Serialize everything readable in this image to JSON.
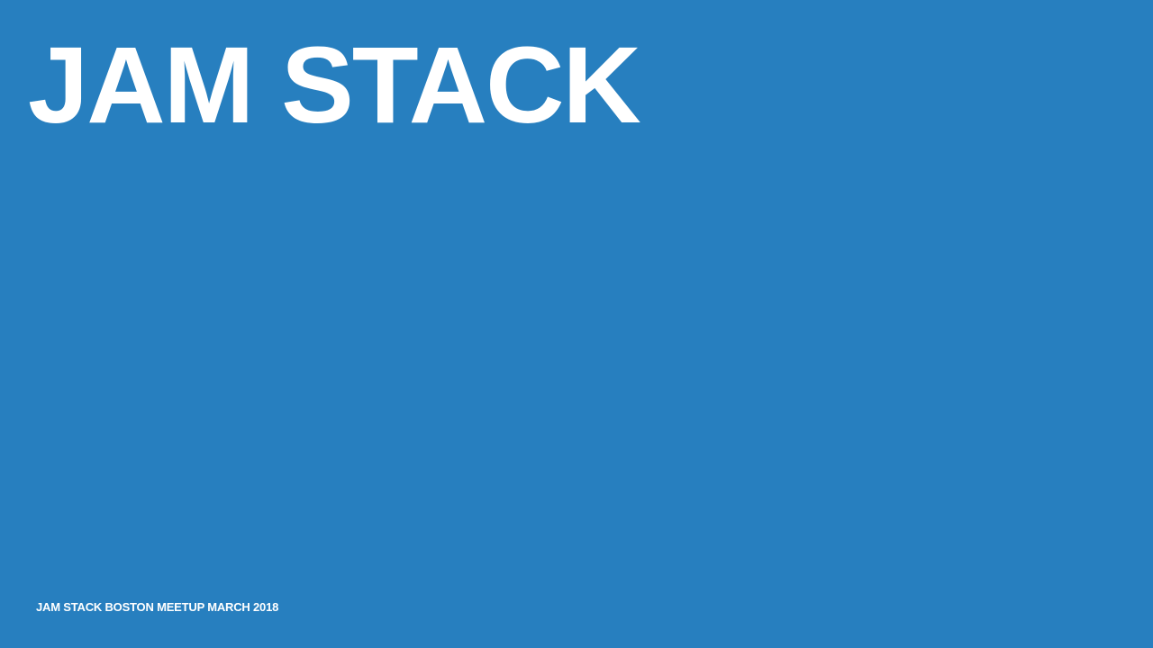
{
  "slide": {
    "title": "JAM STACK",
    "footer": "JAM STACK BOSTON MEETUP MARCH 2018",
    "background_color": "#277fbf",
    "text_color": "#ffffff"
  }
}
